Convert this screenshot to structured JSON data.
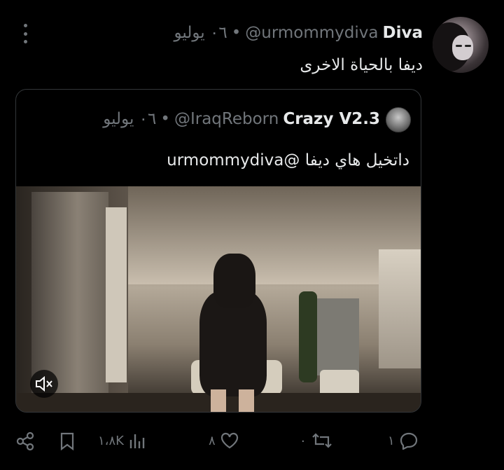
{
  "tweet": {
    "display_name": "Diva",
    "handle": "@urmommydiva",
    "separator": "•",
    "date": "٠٦ يوليو",
    "text": "ديفا بالحياة الاخرى"
  },
  "quoted": {
    "display_name": "Crazy V2.3",
    "handle": "@IraqReborn",
    "separator": "•",
    "date": "٠٦ يوليو",
    "text": "داتخيل هاي ديفا @urmommydiva"
  },
  "actions": {
    "replies": "١",
    "retweets": "٠",
    "likes": "٨",
    "views": "١،٨K"
  },
  "colors": {
    "background": "#000000",
    "text": "#e7e9ea",
    "muted": "#71767b",
    "border": "#333639"
  },
  "icons": [
    "more-icon",
    "mute-icon",
    "reply-icon",
    "retweet-icon",
    "like-icon",
    "views-icon",
    "bookmark-icon",
    "share-icon"
  ]
}
